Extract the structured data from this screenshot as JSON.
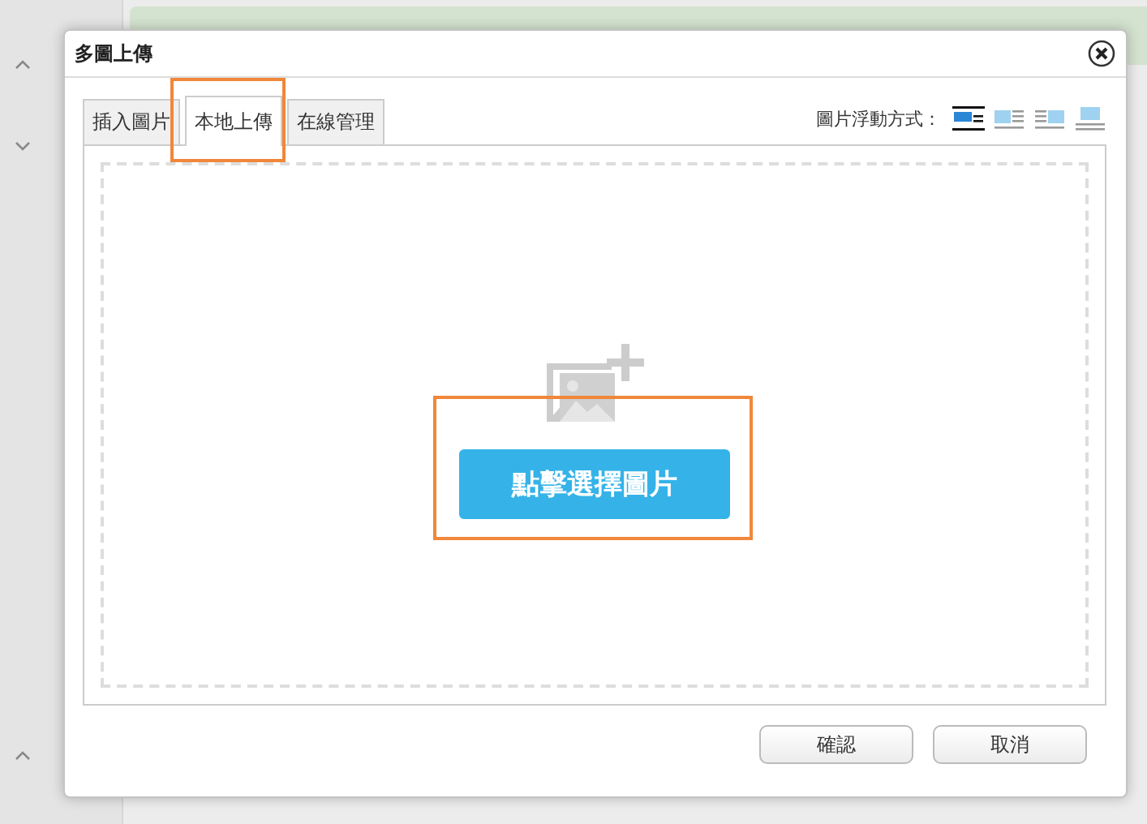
{
  "dialog": {
    "title": "多圖上傳",
    "tabs": [
      {
        "label": "插入圖片",
        "selected": false,
        "highlighted": false
      },
      {
        "label": "本地上傳",
        "selected": true,
        "highlighted": true
      },
      {
        "label": "在線管理",
        "selected": false,
        "highlighted": false
      }
    ],
    "float_label": "圖片浮動方式：",
    "float_options": [
      {
        "kind": "none",
        "selected": true
      },
      {
        "kind": "left",
        "selected": false
      },
      {
        "kind": "right",
        "selected": false
      },
      {
        "kind": "center",
        "selected": false
      }
    ],
    "upload_button": {
      "label": "點擊選擇圖片",
      "highlighted": true
    },
    "buttons": [
      "確認",
      "取消"
    ]
  }
}
